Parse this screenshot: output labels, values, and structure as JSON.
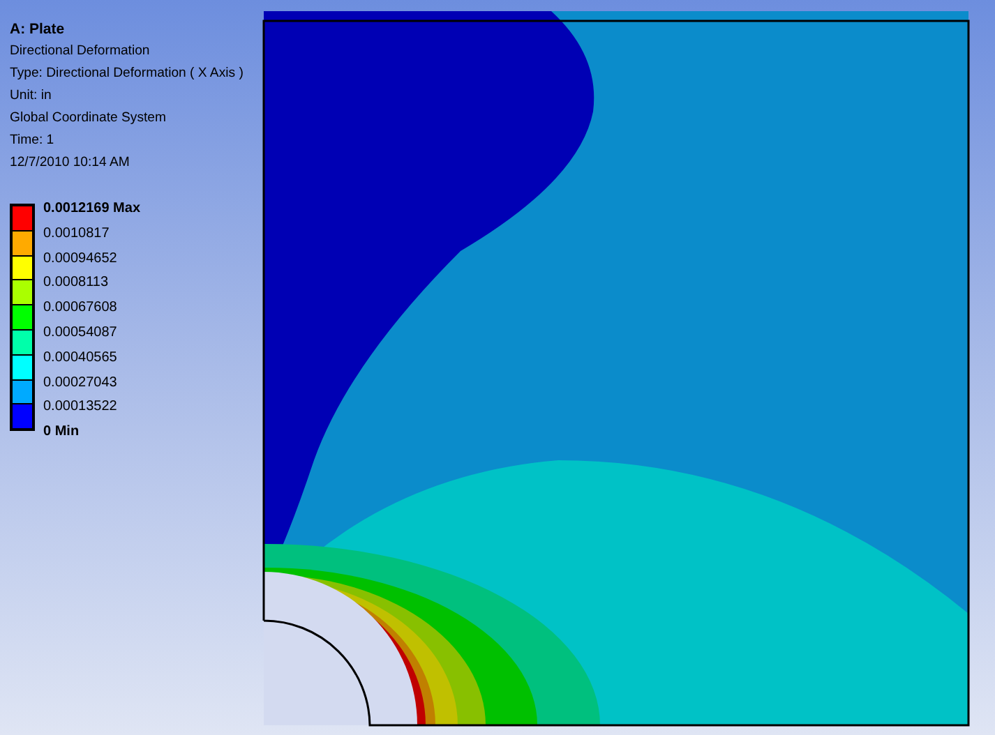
{
  "result": {
    "title": "A: Plate",
    "lines": [
      "Directional Deformation",
      "Type: Directional Deformation ( X Axis )",
      "Unit: in",
      "Global Coordinate System",
      "Time: 1",
      "12/7/2010 10:14 AM"
    ]
  },
  "legend": {
    "labels": [
      {
        "text": "0.0012169 Max",
        "bold": true
      },
      {
        "text": "0.0010817",
        "bold": false
      },
      {
        "text": "0.00094652",
        "bold": false
      },
      {
        "text": "0.0008113",
        "bold": false
      },
      {
        "text": "0.00067608",
        "bold": false
      },
      {
        "text": "0.00054087",
        "bold": false
      },
      {
        "text": "0.00040565",
        "bold": false
      },
      {
        "text": "0.00027043",
        "bold": false
      },
      {
        "text": "0.00013522",
        "bold": false
      },
      {
        "text": "0 Min",
        "bold": true
      }
    ],
    "bands": [
      {
        "color": "#ff0000"
      },
      {
        "color": "#ffaa00"
      },
      {
        "color": "#ffff00"
      },
      {
        "color": "#aaff00"
      },
      {
        "color": "#00ff00"
      },
      {
        "color": "#00ffaa"
      },
      {
        "color": "#00ffff"
      },
      {
        "color": "#00aaff"
      },
      {
        "color": "#0000ff"
      }
    ]
  }
}
